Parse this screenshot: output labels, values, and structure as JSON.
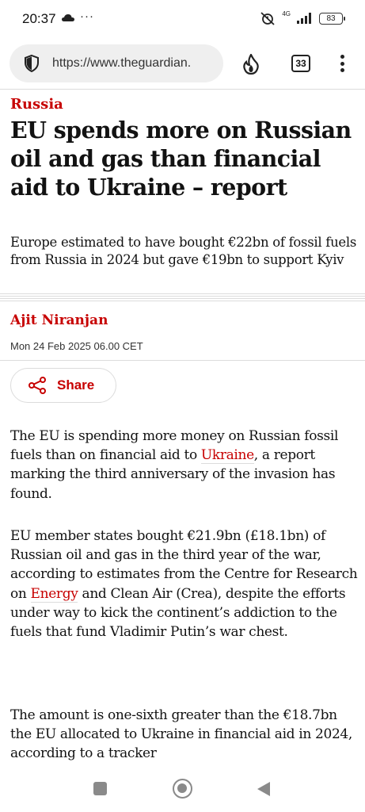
{
  "status_bar": {
    "time": "20:37",
    "extra": "···",
    "network": "4G",
    "battery": "83"
  },
  "browser": {
    "url": "https://www.theguardian.",
    "tab_count": "33"
  },
  "article": {
    "section": "Russia",
    "headline": "EU spends more on Russian oil and gas than financial aid to Ukraine – report",
    "standfirst": "Europe estimated to have bought €22bn of fossil fuels from Russia in 2024 but gave €19bn to support Kyiv",
    "author": "Ajit Niranjan",
    "dateline": "Mon 24 Feb 2025 06.00 CET",
    "share_label": "Share",
    "p1": {
      "a": "The EU is spending more money on Russian fossil fuels than on financial aid to ",
      "link": "Ukraine",
      "b": ", a report marking the third anniversary of the invasion has found."
    },
    "p2": {
      "a": "EU member states bought €21.9bn (£18.1bn) of Russian oil and gas in the third year of the war, according to estimates from the Centre for Research on ",
      "link": "Energy",
      "b": " and Clean Air (Crea), despite the efforts under way to kick the continent’s addiction to the fuels that fund Vladimir Putin’s war chest."
    },
    "p3": "The amount is one-sixth greater than the €18.7bn the EU allocated to Ukraine in financial aid in 2024, according to a tracker"
  },
  "colors": {
    "accent": "#c70000",
    "text": "#121212",
    "rule": "#dcdcdc"
  },
  "icons": {
    "status": [
      "cloud-icon",
      "muted-alarm-icon",
      "signal-icon",
      "battery-icon"
    ],
    "browser": [
      "shield-icon",
      "flame-icon",
      "tabs-icon",
      "more-vert-icon"
    ],
    "share": "share-icon",
    "nav": [
      "recents-icon",
      "home-icon",
      "back-icon"
    ]
  }
}
